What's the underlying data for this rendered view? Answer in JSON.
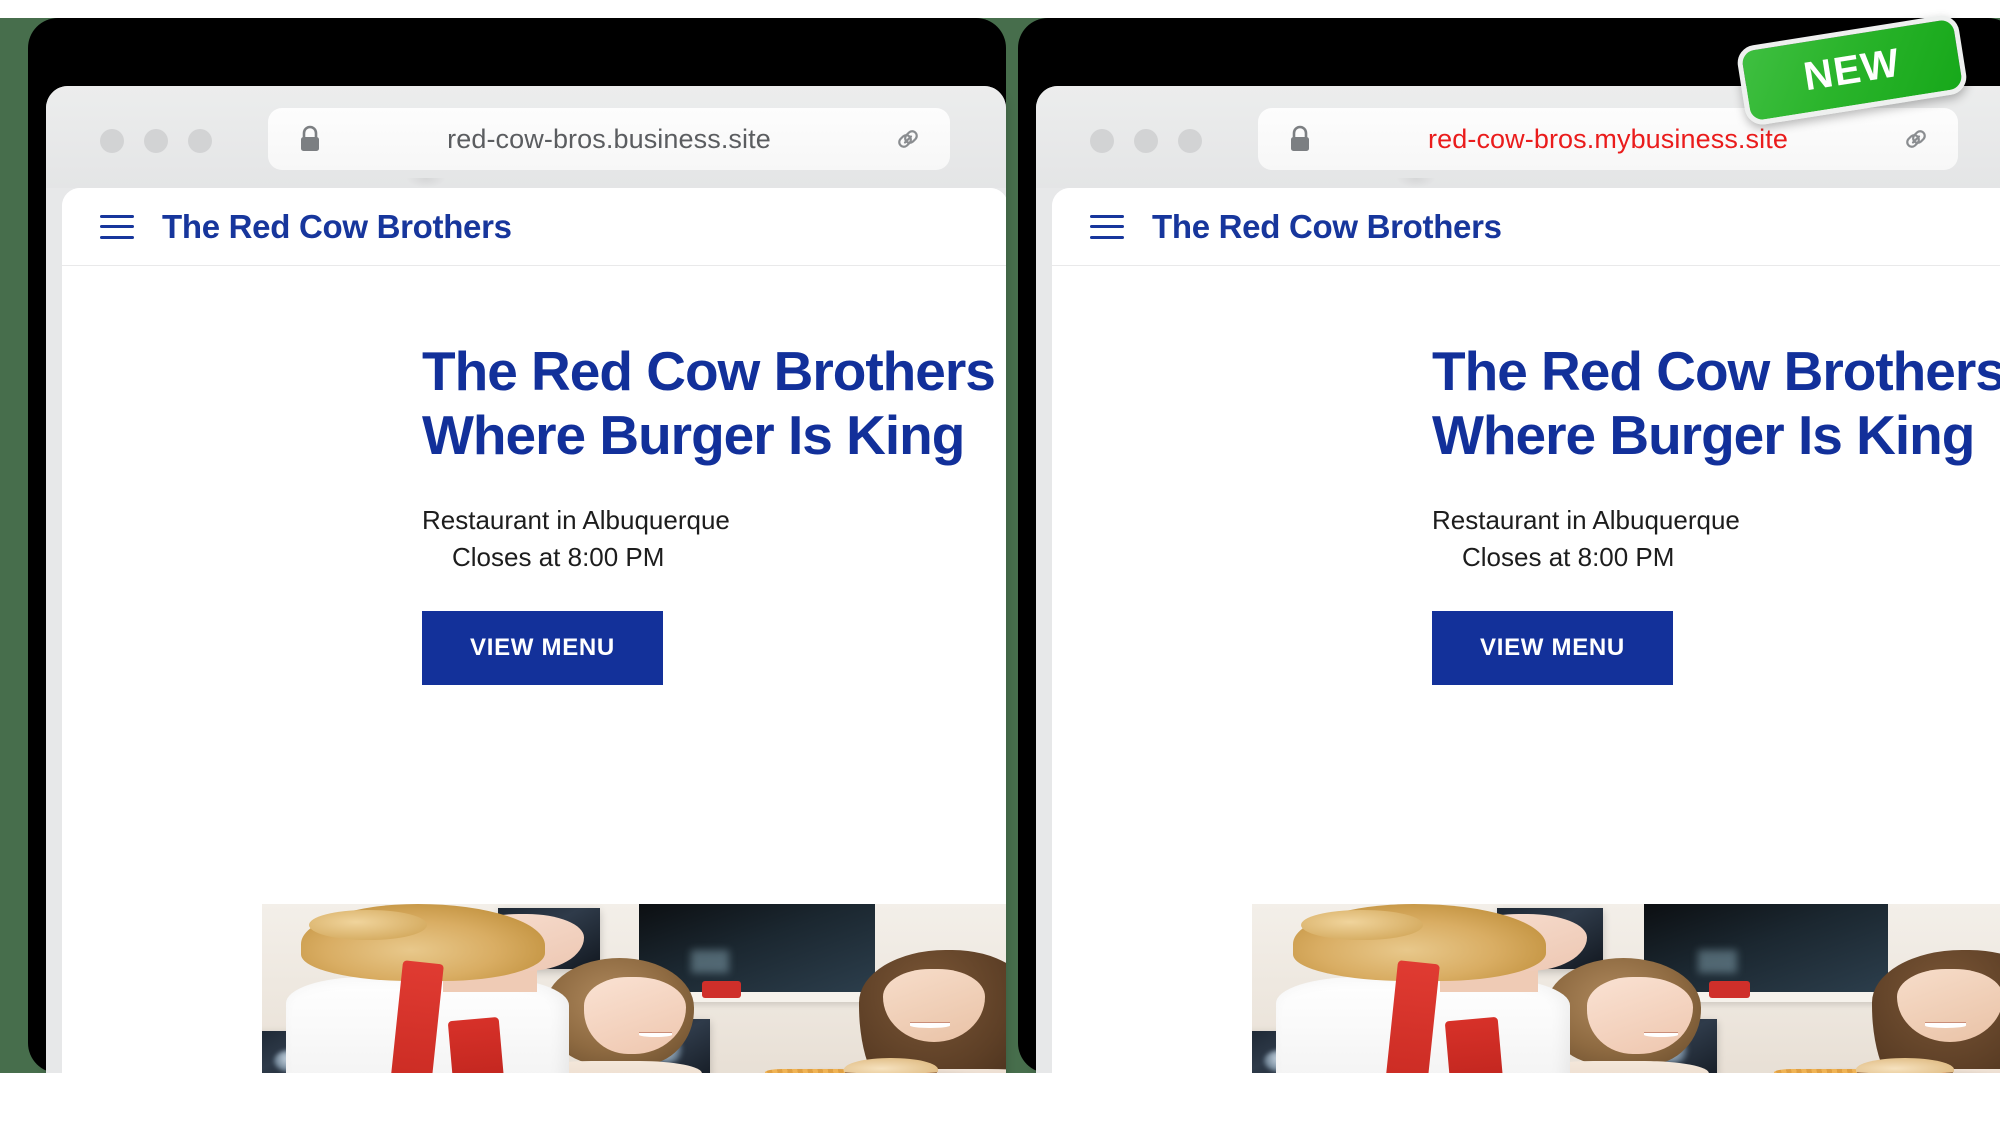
{
  "background": {
    "backdrop_color": "#476e4c",
    "frame_color": "#000000"
  },
  "badge": {
    "label": "NEW",
    "bg_color": "#2ab42b",
    "text_color": "#ffffff"
  },
  "panels": [
    {
      "id": "before",
      "browser": {
        "lock_icon": "lock-icon",
        "url": "red-cow-bros.business.site",
        "url_color": "#5b5d60",
        "link_icon": "link-icon",
        "window_dots": 3
      },
      "site": {
        "menu_icon": "hamburger-menu-icon",
        "brand": "The Red Cow Brothers",
        "brand_color": "#17369c",
        "hero": {
          "title_line1": "The Red Cow Brothers —",
          "title_line2": "Where Burger Is King",
          "title_color": "#12309a",
          "subtitle_line1": "Restaurant in Albuquerque",
          "subtitle_line2": "Closes at 8:00 PM",
          "cta_label": "VIEW MENU",
          "cta_color": "#13319a"
        },
        "photo_alt": "Restaurant worker in red apron serving two smiling girls a burger and fries"
      }
    },
    {
      "id": "after",
      "browser": {
        "lock_icon": "lock-icon",
        "url": "red-cow-bros.mybusiness.site",
        "url_color": "#ea1c1c",
        "link_icon": "link-icon",
        "window_dots": 3
      },
      "site": {
        "menu_icon": "hamburger-menu-icon",
        "brand": "The Red Cow Brothers",
        "brand_color": "#17369c",
        "hero": {
          "title_line1": "The Red Cow Brothers —",
          "title_line2": "Where Burger Is King",
          "title_color": "#12309a",
          "subtitle_line1": "Restaurant in Albuquerque",
          "subtitle_line2": "Closes at 8:00 PM",
          "cta_label": "VIEW MENU",
          "cta_color": "#13319a"
        },
        "photo_alt": "Restaurant worker in red apron serving two smiling girls a burger and fries"
      }
    }
  ]
}
